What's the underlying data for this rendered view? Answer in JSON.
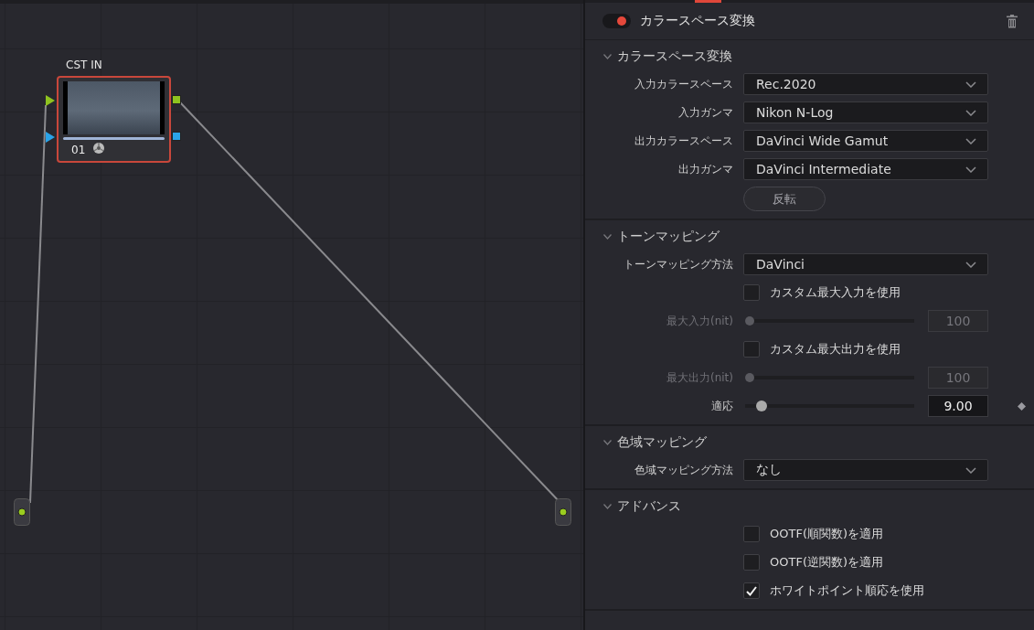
{
  "node_editor": {
    "node": {
      "label": "CST IN",
      "number": "01",
      "selected": true
    }
  },
  "effect": {
    "title": "カラースペース変換",
    "enabled": true
  },
  "sections": [
    {
      "title": "カラースペース変換",
      "expanded": true,
      "rows": [
        {
          "kind": "dropdown",
          "label": "入力カラースペース",
          "value": "Rec.2020"
        },
        {
          "kind": "dropdown",
          "label": "入力ガンマ",
          "value": "Nikon N-Log"
        },
        {
          "kind": "dropdown",
          "label": "出力カラースペース",
          "value": "DaVinci Wide Gamut"
        },
        {
          "kind": "dropdown",
          "label": "出力ガンマ",
          "value": "DaVinci Intermediate"
        },
        {
          "kind": "button",
          "label": "反転"
        }
      ]
    },
    {
      "title": "トーンマッピング",
      "expanded": true,
      "rows": [
        {
          "kind": "dropdown",
          "label": "トーンマッピング方法",
          "value": "DaVinci"
        },
        {
          "kind": "checkbox",
          "label": "カスタム最大入力を使用",
          "checked": false
        },
        {
          "kind": "slider",
          "label": "最大入力(nit)",
          "level": 0,
          "value": "100",
          "disabled": true,
          "keyframe": false
        },
        {
          "kind": "checkbox",
          "label": "カスタム最大出力を使用",
          "checked": false
        },
        {
          "kind": "slider",
          "label": "最大出力(nit)",
          "level": 0,
          "value": "100",
          "disabled": true,
          "keyframe": false
        },
        {
          "kind": "slider",
          "label": "適応",
          "level": 0.07,
          "value": "9.00",
          "disabled": false,
          "keyframe": true
        }
      ]
    },
    {
      "title": "色域マッピング",
      "expanded": true,
      "rows": [
        {
          "kind": "dropdown",
          "label": "色域マッピング方法",
          "value": "なし"
        }
      ]
    },
    {
      "title": "アドバンス",
      "expanded": true,
      "rows": [
        {
          "kind": "checkbox",
          "label": "OOTF(順関数)を適用",
          "checked": false
        },
        {
          "kind": "checkbox",
          "label": "OOTF(逆関数)を適用",
          "checked": false
        },
        {
          "kind": "checkbox",
          "label": "ホワイトポイント順応を使用",
          "checked": true
        }
      ]
    }
  ]
}
